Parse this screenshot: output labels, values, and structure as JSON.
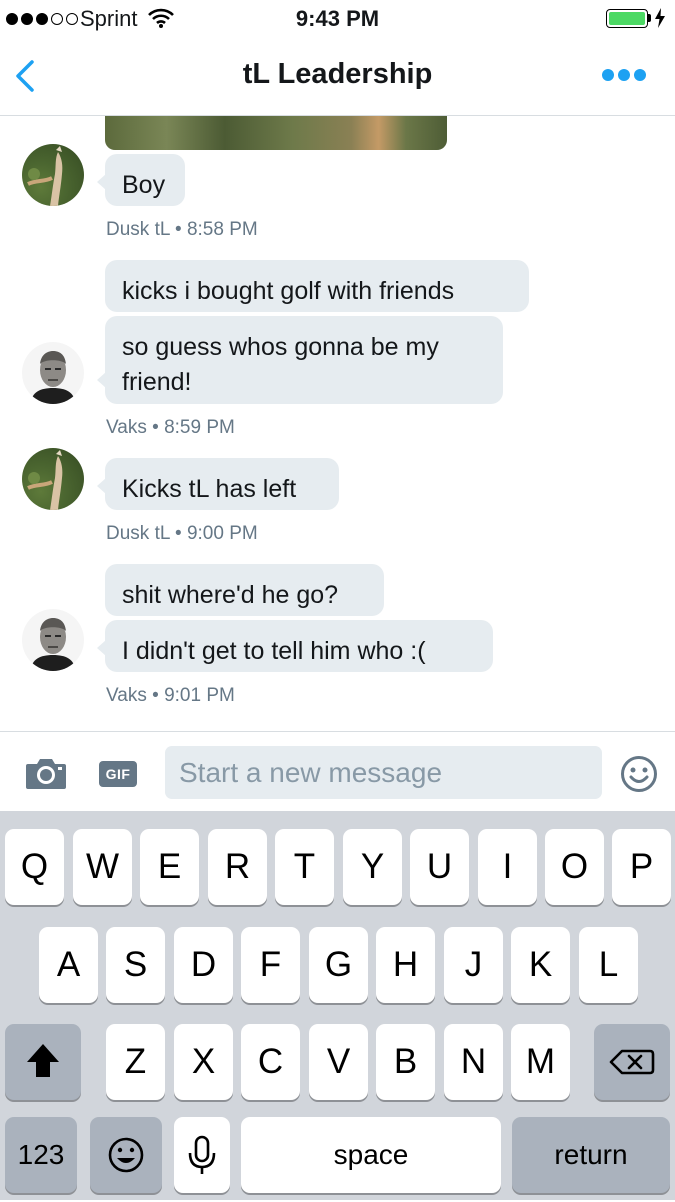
{
  "status_bar": {
    "carrier": "Sprint",
    "time": "9:43 PM",
    "signal_bars_filled": 3,
    "signal_bars_total": 5,
    "battery_level": 1.0,
    "battery_color": "#4cd964"
  },
  "header": {
    "title": "tL Leadership",
    "back_icon": "chevron-left-icon",
    "more_icon": "more-dots-icon",
    "accent_color": "#1da1f2"
  },
  "messages": {
    "m1": {
      "text": "Boy"
    },
    "meta1": {
      "sender": "Dusk tL",
      "sep": "•",
      "time": "8:58 PM"
    },
    "m2": {
      "text": "kicks i bought golf with friends"
    },
    "m3": {
      "line1": "so guess whos gonna be my",
      "line2": "friend!"
    },
    "meta2": {
      "sender": "Vaks",
      "sep": "•",
      "time": "8:59 PM"
    },
    "m4": {
      "text": "Kicks tL has left"
    },
    "meta3": {
      "sender": "Dusk tL",
      "sep": "•",
      "time": "9:00 PM"
    },
    "m5": {
      "text": "shit where'd he go?"
    },
    "m6": {
      "text": "I didn't get to tell him who :("
    },
    "meta4": {
      "sender": "Vaks",
      "sep": "•",
      "time": "9:01 PM"
    }
  },
  "composer": {
    "camera_icon": "camera-icon",
    "gif_label": "GIF",
    "placeholder": "Start a new message",
    "emoji_icon": "smiley-icon"
  },
  "keyboard": {
    "row1": [
      "Q",
      "W",
      "E",
      "R",
      "T",
      "Y",
      "U",
      "I",
      "O",
      "P"
    ],
    "row2": [
      "A",
      "S",
      "D",
      "F",
      "G",
      "H",
      "J",
      "K",
      "L"
    ],
    "row3": [
      "Z",
      "X",
      "C",
      "V",
      "B",
      "N",
      "M"
    ],
    "shift_icon": "shift-arrow-icon",
    "delete_icon": "backspace-icon",
    "numbers_label": "123",
    "emoji_key_icon": "emoji-keyboard-icon",
    "mic_icon": "microphone-icon",
    "space_label": "space",
    "return_label": "return"
  }
}
